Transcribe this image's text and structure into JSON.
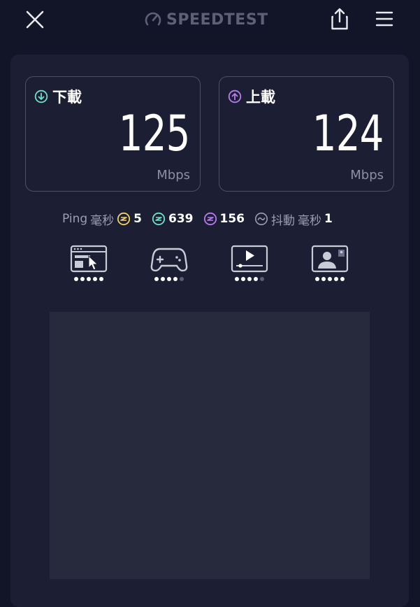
{
  "header": {
    "logo_text": "SPEEDTEST",
    "close_icon": "close-icon",
    "share_icon": "share-icon",
    "menu_icon": "menu-icon"
  },
  "download": {
    "label": "下載",
    "value": "125",
    "unit": "Mbps",
    "icon": "arrow-down-circle-icon",
    "accent": "#6fe0c6"
  },
  "upload": {
    "label": "上載",
    "value": "124",
    "unit": "Mbps",
    "icon": "arrow-up-circle-icon",
    "accent": "#b57cf0"
  },
  "ping": {
    "label": "Ping",
    "unit": "毫秒",
    "idle": "5",
    "download": "639",
    "upload": "156",
    "jitter_label": "抖動",
    "jitter_unit": "毫秒",
    "jitter": "1",
    "colors": {
      "idle": "#f2d063",
      "download": "#6fe0c6",
      "upload": "#b57cf0",
      "jitter": "#9a9eb5"
    }
  },
  "apps": [
    {
      "name": "browsing",
      "icon": "web-browsing-icon",
      "rating": 5,
      "max": 5
    },
    {
      "name": "gaming",
      "icon": "gamepad-icon",
      "rating": 4,
      "max": 5
    },
    {
      "name": "video",
      "icon": "video-streaming-icon",
      "rating": 4,
      "max": 5
    },
    {
      "name": "video-chat",
      "icon": "video-chat-icon",
      "rating": 5,
      "max": 5
    }
  ]
}
